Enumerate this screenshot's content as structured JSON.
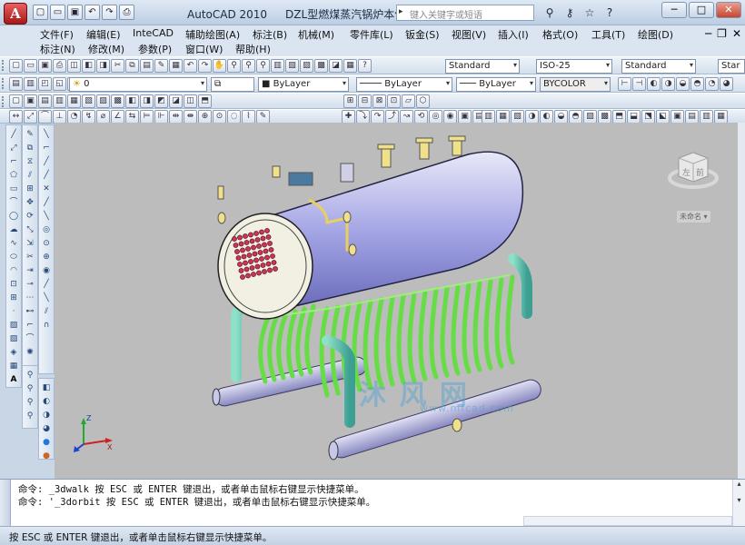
{
  "titlebar": {
    "app_letter": "A",
    "app_name": "AutoCAD 2010",
    "drawing_name": "DZL型燃煤蒸汽锅炉本体",
    "search_placeholder": "键入关键字或短语",
    "window_min": "─",
    "window_max": "□",
    "window_close": "✕"
  },
  "qat_icons": [
    "new-icon",
    "open-icon",
    "save-icon",
    "undo-icon",
    "redo-icon",
    "plot-icon"
  ],
  "help_icons": [
    "binoculars-icon",
    "key-icon",
    "star-icon",
    "help-icon"
  ],
  "menu": {
    "row1": [
      "文件(F)",
      "编辑(E)",
      "InteCAD",
      "辅助绘图(A)",
      "标注(B)",
      "机械(M)",
      "零件库(L)",
      "钣金(S)",
      "视图(V)",
      "插入(I)",
      "格式(O)",
      "工具(T)",
      "绘图(D)"
    ],
    "row2": [
      "标注(N)",
      "修改(M)",
      "参数(P)",
      "窗口(W)",
      "帮助(H)"
    ],
    "doc_controls": [
      "─",
      "❐",
      "✕"
    ]
  },
  "toolbar1": {
    "text_style": "Standard",
    "dim_style": "ISO-25",
    "table_style": "Standard",
    "multileader_style": "Star"
  },
  "toolbar2": {
    "layer_value": "0",
    "color_value": "ByLayer",
    "linetype_value": "ByLayer",
    "lineweight_value": "ByLayer",
    "plotstyle_value": "BYCOLOR"
  },
  "viewcube": {
    "left_face": "左",
    "front_face": "前",
    "label": "未命名"
  },
  "ucs": {
    "z": "Z",
    "x": "X",
    "y": "Y"
  },
  "watermark": {
    "text": "沐 风 网",
    "url": "www.mfcad.com"
  },
  "command_lines": [
    "命令: _3dwalk 按 ESC 或 ENTER 键退出，或者单击鼠标右键显示快捷菜单。",
    "命令: '_3dorbit 按 ESC 或 ENTER 键退出，或者单击鼠标右键显示快捷菜单。"
  ],
  "statusbar": {
    "text": "按 ESC 或 ENTER 键退出，或者单击鼠标右键显示快捷菜单。"
  },
  "colors": {
    "boiler_drum": "#a3a4e4",
    "tubes": "#66dd44",
    "headers": "#a8a8d8",
    "canvas_bg": "#bcbcbc",
    "tube_ends": "#cc3355"
  }
}
